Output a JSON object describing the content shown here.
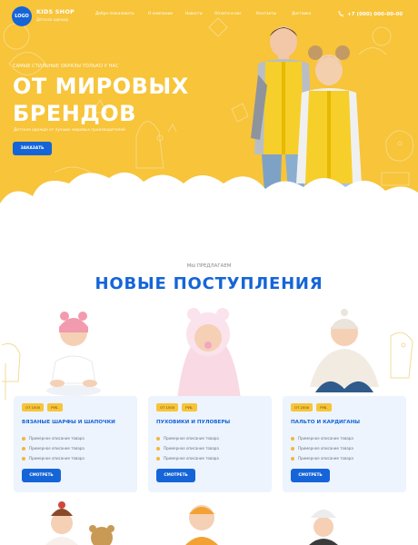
{
  "header": {
    "logo": "LOGO",
    "brand": "KIDS SHOP",
    "tagline": "Детская одежда",
    "nav": [
      "Добро пожаловать",
      "О компании",
      "Новости",
      "Оплата и вас",
      "Контакты",
      "Доставка"
    ],
    "phone": "+7 (000) 000-00-00"
  },
  "hero": {
    "eyebrow": "САМЫЕ СТИЛЬНЫЕ ОБРАЗЫ ТОЛЬКО У НАС",
    "headline_line1": "ОТ МИРОВЫХ",
    "headline_line2": "БРЕНДОВ",
    "subtitle": "Детская одежда от лучших мировых производителей",
    "cta": "ЗАКАЗАТЬ"
  },
  "section": {
    "eyebrow": "МЫ ПРЕДЛАГАЕМ",
    "title": "НОВЫЕ ПОСТУПЛЕНИЯ"
  },
  "cards": [
    {
      "tag_price": "ОТ 1000",
      "tag_currency": "РУБ.",
      "title": "ВЯЗАНЫЕ ШАРФЫ И ШАПОЧКИ",
      "features": [
        "Примерное описание товара",
        "Примерное описание товара",
        "Примерное описание товара"
      ],
      "button": "СМОТРЕТЬ"
    },
    {
      "tag_price": "ОТ 1500",
      "tag_currency": "РУБ.",
      "title": "ПУХОВИКИ И ПУЛОВЕРЫ",
      "features": [
        "Примерное описание товара",
        "Примерное описание товара",
        "Примерное описание товара"
      ],
      "button": "СМОТРЕТЬ"
    },
    {
      "tag_price": "ОТ 2000",
      "tag_currency": "РУБ.",
      "title": "ПАЛЬТО И КАРДИГАНЫ",
      "features": [
        "Примерное описание товара",
        "Примерное описание товара",
        "Примерное описание товара"
      ],
      "button": "СМОТРЕТЬ"
    }
  ],
  "colors": {
    "hero_yellow": "#f7c43a",
    "accent_blue": "#1565d8",
    "card_bg": "#edf4fd",
    "tag_yellow": "#f7c43a"
  },
  "icons": [
    "phone-icon"
  ]
}
